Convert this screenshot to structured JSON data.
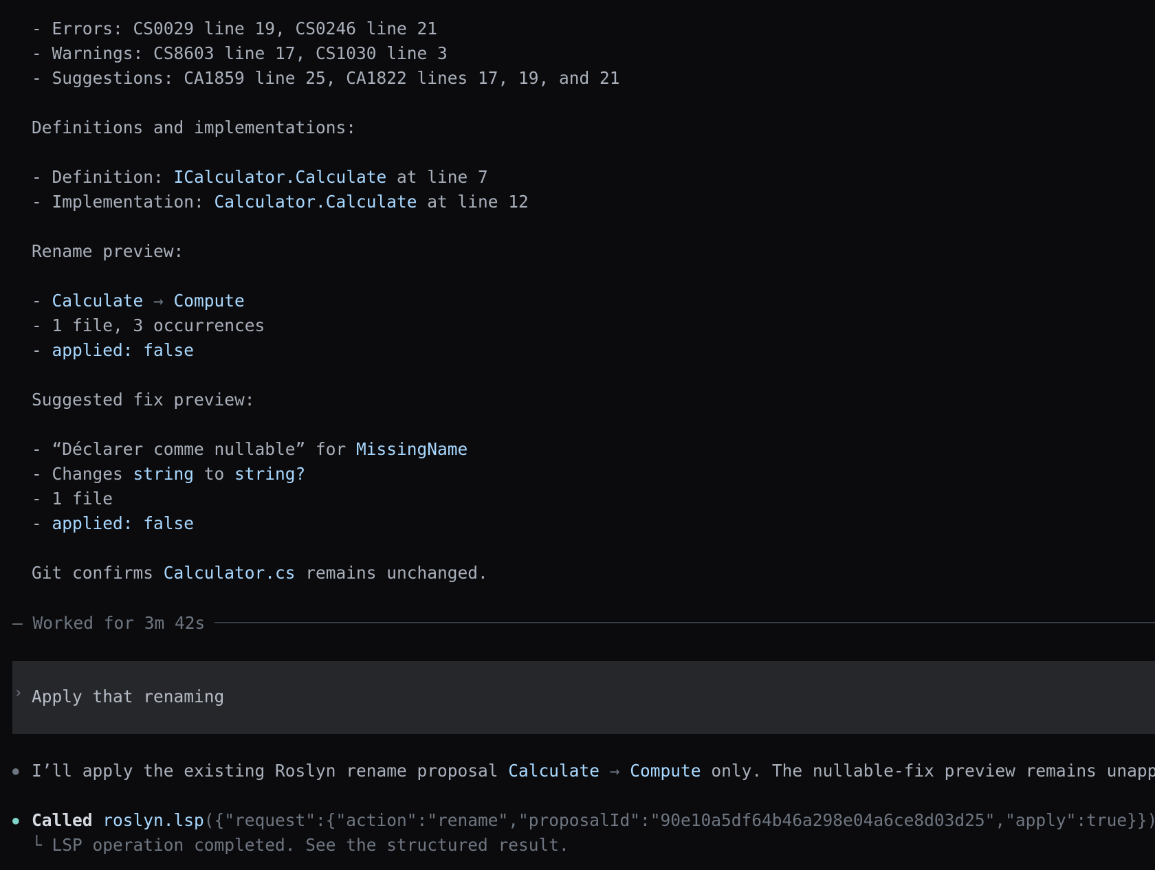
{
  "summary": {
    "errors": {
      "prefix": "- Errors: ",
      "text": "CS0029 line 19, CS0246 line 21"
    },
    "warnings": {
      "prefix": "- Warnings: ",
      "text": "CS8603 line 17, CS1030 line 3"
    },
    "suggestions": {
      "prefix": "- Suggestions: ",
      "text": "CA1859 line 25, CA1822 lines 17, 19, and 21"
    }
  },
  "definitions": {
    "heading": "Definitions and implementations:",
    "definition": {
      "prefix": "- Definition: ",
      "symbol": "ICalculator.Calculate",
      "suffix": " at line 7"
    },
    "implementation": {
      "prefix": "- Implementation: ",
      "symbol": "Calculator.Calculate",
      "suffix": " at line 12"
    }
  },
  "rename_preview": {
    "heading": "Rename preview:",
    "dash": "- ",
    "from": "Calculate",
    "arrow": " → ",
    "to": "Compute",
    "scope": "- 1 file, 3 occurrences",
    "applied": "applied: false"
  },
  "fix_preview": {
    "heading": "Suggested fix preview:",
    "title_prefix": "- “Déclarer comme nullable” for ",
    "symbol": "MissingName",
    "changes_prefix": "- Changes ",
    "from_type": "string",
    "to_word": " to ",
    "to_type": "string?",
    "scope": "- 1 file",
    "applied": "applied: false"
  },
  "git": {
    "prefix": "Git confirms ",
    "file": "Calculator.cs",
    "suffix": " remains unchanged."
  },
  "separator": {
    "label": "— Worked for 3m 42s"
  },
  "prompt": {
    "chevron": "›",
    "text": "Apply that renaming"
  },
  "assistant": {
    "prefix": "I’ll apply the existing Roslyn rename proposal ",
    "from": "Calculate",
    "arrow": " → ",
    "to": "Compute",
    "suffix": " only. The nullable-fix preview remains unapplied."
  },
  "tool_call": {
    "called": "Called",
    "tool": "roslyn.lsp",
    "args": "({\"request\":{\"action\":\"rename\",\"proposalId\":\"90e10a5df64b46a298e04a6ce8d03d25\",\"apply\":true}})",
    "result_glyph": "└",
    "result": "LSP operation completed. See the structured result."
  },
  "colors": {
    "background": "#0b0b0d",
    "text": "#a9b0bb",
    "highlight": "#a8d8ff",
    "dim": "#6e7681",
    "prompt_bg": "#26272b",
    "success_bullet": "#7fd3c9"
  }
}
